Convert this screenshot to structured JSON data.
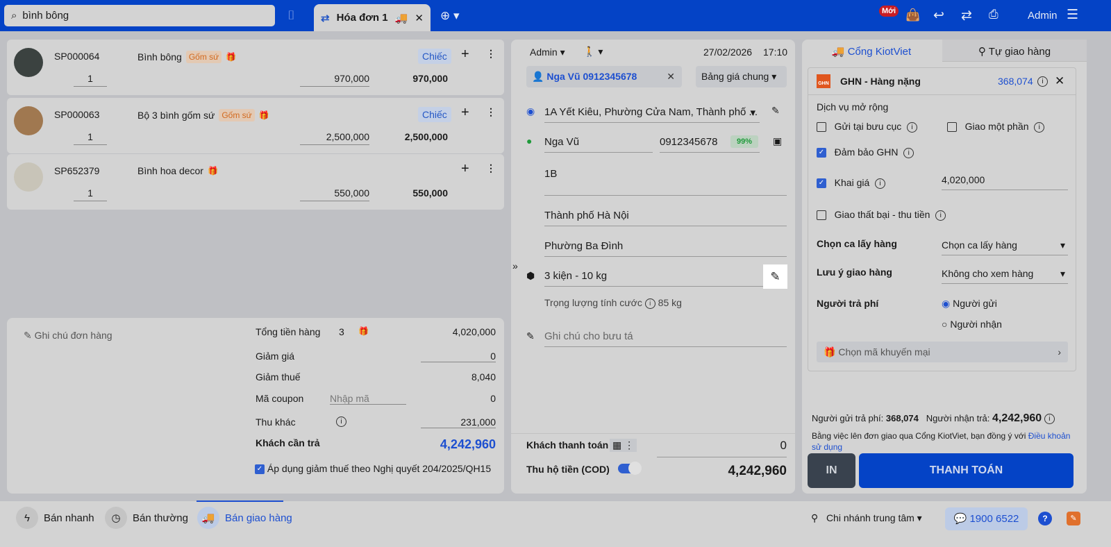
{
  "header": {
    "search_value": "bình bông",
    "invoice_tab": "Hóa đơn 1",
    "new_badge": "Mới",
    "user": "Admin"
  },
  "products": [
    {
      "code": "SP000064",
      "name": "Bình bông",
      "tag": "Gốm sứ",
      "unit": "Chiếc",
      "qty": "1",
      "price": "970,000",
      "total": "970,000"
    },
    {
      "code": "SP000063",
      "name": "Bộ 3 bình gốm sứ",
      "tag": "Gốm sứ",
      "unit": "Chiếc",
      "qty": "1",
      "price": "2,500,000",
      "total": "2,500,000"
    },
    {
      "code": "SP652379",
      "name": "Bình hoa decor",
      "qty": "1",
      "price": "550,000",
      "total": "550,000"
    }
  ],
  "summary": {
    "note_placeholder": "Ghi chú đơn hàng",
    "total_goods_label": "Tổng tiền hàng",
    "total_goods_count": "3",
    "total_goods": "4,020,000",
    "discount_label": "Giảm giá",
    "discount": "0",
    "tax_label": "Giảm thuế",
    "tax": "8,040",
    "coupon_label": "Mã coupon",
    "coupon_placeholder": "Nhập mã",
    "coupon": "0",
    "other_label": "Thu khác",
    "other": "231,000",
    "due_label": "Khách cần trả",
    "due": "4,242,960",
    "tax_policy": "Áp dụng giảm thuế theo Nghị quyết 204/2025/QH15"
  },
  "delivery": {
    "seller": "Admin",
    "date": "27/02/2026",
    "time": "17:10",
    "customer": "Nga Vũ 0912345678",
    "price_list": "Bảng giá chung",
    "from_address": "1A Yết Kiêu, Phường Cửa Nam, Thành phố ...",
    "receiver_name": "Nga Vũ",
    "receiver_phone": "0912345678",
    "match": "99%",
    "address": "1B",
    "city": "Thành phố Hà Nội",
    "ward": "Phường Ba Đình",
    "package": "3 kiện - 10 kg",
    "weight_label": "Trọng lượng tính cước",
    "weight": "85 kg",
    "courier_note": "Ghi chú cho bưu tá",
    "pay_label": "Khách thanh toán",
    "pay": "0",
    "cod_label": "Thu hộ tiền (COD)",
    "cod": "4,242,960"
  },
  "shipping": {
    "tab1": "Cổng KiotViet",
    "tab2": "Tự giao hàng",
    "carrier": "GHN - Hàng nặng",
    "fee": "368,074",
    "ext_title": "Dịch vụ mở rộng",
    "opt1": "Gửi tại bưu cục",
    "opt2": "Giao một phần",
    "opt3": "Đảm bảo GHN",
    "opt4": "Khai giá",
    "declared": "4,020,000",
    "opt5": "Giao thất bại - thu tiền",
    "shift_label": "Chọn ca lấy hàng",
    "shift": "Chọn ca lấy hàng",
    "note_label": "Lưu ý giao hàng",
    "note": "Không cho xem hàng",
    "payer_label": "Người trả phí",
    "payer1": "Người gửi",
    "payer2": "Người nhận",
    "promo": "Chọn mã khuyến mại",
    "sender_pays_label": "Người gửi trả phí:",
    "sender_pays": "368,074",
    "receiver_pays_label": "Người nhận trả:",
    "receiver_pays": "4,242,960",
    "terms": "Bằng việc lên đơn giao qua Cổng KiotViet, bạn đồng ý với ",
    "terms_link": "Điều khoản sử dụng",
    "print": "IN",
    "pay": "THANH TOÁN"
  },
  "footer": {
    "quick": "Bán nhanh",
    "normal": "Bán thường",
    "delivery": "Bán giao hàng",
    "branch": "Chi nhánh trung tâm",
    "hotline": "1900 6522"
  }
}
